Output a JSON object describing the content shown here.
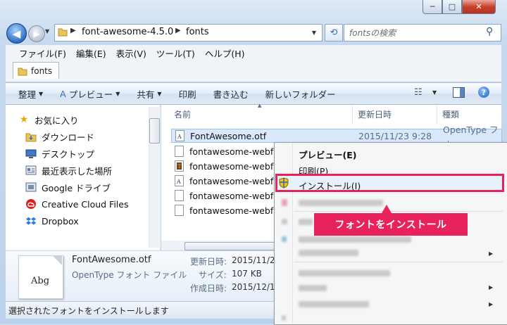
{
  "window": {
    "min_glyph": "─",
    "max_glyph": "□",
    "close_glyph": "✕"
  },
  "address": {
    "crumbs": [
      "font-awesome-4.5.0",
      "fonts"
    ],
    "search_placeholder": "fontsの検索"
  },
  "menubar": [
    "ファイル(F)",
    "編集(E)",
    "表示(V)",
    "ツール(T)",
    "ヘルプ(H)"
  ],
  "tab": {
    "label": "fonts"
  },
  "commands": {
    "organize": "整理",
    "preview": "プレビュー",
    "share": "共有",
    "print": "印刷",
    "burn": "書き込む",
    "new_folder": "新しいフォルダー"
  },
  "nav": {
    "favorites": "お気に入り",
    "items": [
      "ダウンロード",
      "デスクトップ",
      "最近表示した場所",
      "Google ドライブ",
      "Creative Cloud Files",
      "Dropbox"
    ]
  },
  "columns": {
    "name": "名前",
    "date": "更新日時",
    "type": "種類"
  },
  "files": [
    {
      "name": "FontAwesome.otf",
      "date": "2015/11/23 9:28",
      "type": "OpenType フォ"
    },
    {
      "name": "fontawesome-webfont"
    },
    {
      "name": "fontawesome-webfont"
    },
    {
      "name": "fontawesome-webfont"
    },
    {
      "name": "fontawesome-webfont"
    },
    {
      "name": "fontawesome-webfont"
    }
  ],
  "details": {
    "thumb_text": "Abg",
    "filename": "FontAwesome.otf",
    "filetype": "OpenType フォント ファイル",
    "modified_label": "更新日時:",
    "modified_value": "2015/11/2",
    "size_label": "サイズ:",
    "size_value": "107 KB",
    "created_label": "作成日時:",
    "created_value": "2015/12/1"
  },
  "status": {
    "text": "選択されたフォントをインストールします"
  },
  "context_menu": {
    "preview": "プレビュー(E)",
    "print": "印刷(P)",
    "install": "インストール(I)"
  },
  "callout": {
    "text": "フォントをインストール"
  },
  "colors": {
    "accent": "#e8235b",
    "selection": "#d9e9fb"
  }
}
